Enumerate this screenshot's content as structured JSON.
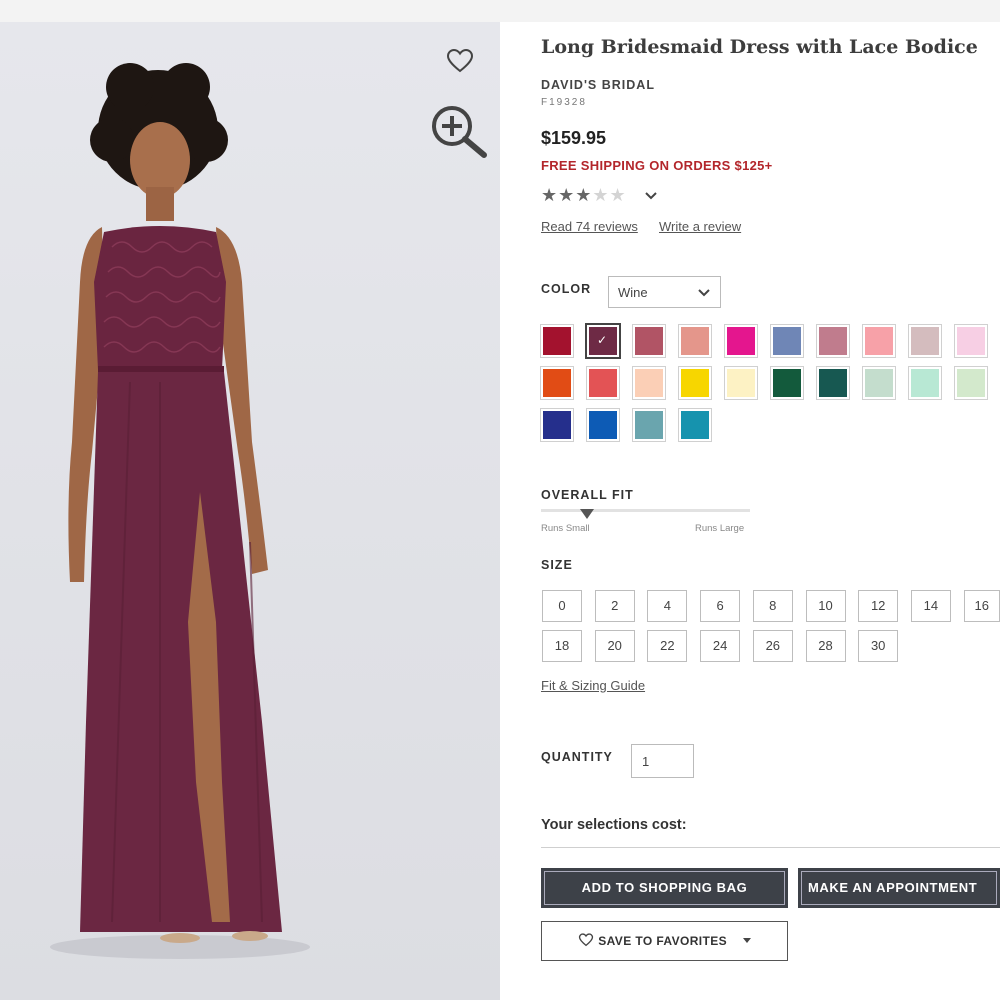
{
  "product": {
    "title": "Long Bridesmaid Dress with Lace Bodice",
    "brand": "DAVID'S BRIDAL",
    "sku": "F19328",
    "price": "$159.95",
    "shipping_note": "FREE SHIPPING ON ORDERS $125+"
  },
  "rating": {
    "stars_filled": 3,
    "stars_total": 5,
    "stars_on": "★★★",
    "stars_off": "★★",
    "read_reviews": "Read 74 reviews",
    "write_review": "Write a review"
  },
  "color": {
    "label": "COLOR",
    "selected": "Wine",
    "swatches": [
      "#a3122e",
      "#6e2a45",
      "#b15465",
      "#e4968b",
      "#e4168e",
      "#6f86b6",
      "#c07c8d",
      "#f7a1a8",
      "#d4bcbe",
      "#f7cfe4",
      "#d8d8d8",
      "#e14c15",
      "#e35355",
      "#fbcfb6",
      "#f7d600",
      "#fdf2c4",
      "#135a3c",
      "#175851",
      "#c4ddcd",
      "#b8e8d4",
      "#d3e9cc",
      "#dadada",
      "#252f8c",
      "#0d5bb5",
      "#6aa5ae",
      "#1693ae"
    ],
    "selected_index": 1
  },
  "fit": {
    "label": "OVERALL FIT",
    "left_caption": "Runs Small",
    "right_caption": "Runs Large",
    "position": 0.22
  },
  "size": {
    "label": "SIZE",
    "options": [
      "0",
      "2",
      "4",
      "6",
      "8",
      "10",
      "12",
      "14",
      "16",
      "18",
      "20",
      "22",
      "24",
      "26",
      "28",
      "30"
    ],
    "guide_link": "Fit & Sizing Guide"
  },
  "quantity": {
    "label": "QUANTITY",
    "value": "1"
  },
  "summary": {
    "cost_label": "Your selections cost:"
  },
  "actions": {
    "add_to_bag": "ADD TO SHOPPING BAG",
    "appointment": "MAKE AN APPOINTMENT",
    "save_favorites": "SAVE TO FAVORITES"
  },
  "icons": {
    "favorite": "heart-icon",
    "zoom": "zoom-in-icon",
    "dropdown": "chevron-down-icon",
    "fit_marker": "triangle-marker-icon",
    "caret": "caret-down-icon"
  },
  "model_dress_color": "#6e2a45"
}
